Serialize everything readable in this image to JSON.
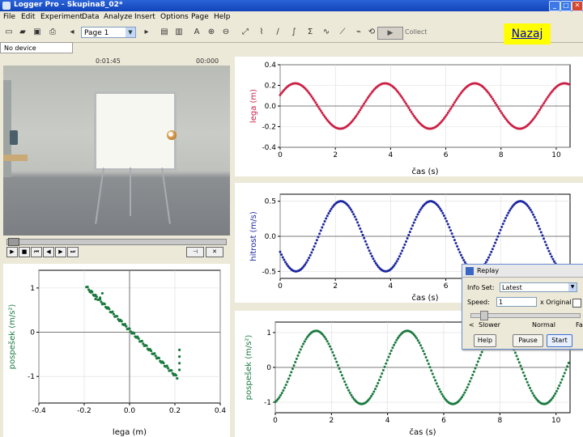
{
  "window": {
    "title": "Logger Pro - Skupina8_02*",
    "min_glyph": "_",
    "max_glyph": "□",
    "close_glyph": "✕"
  },
  "menu": [
    "File",
    "Edit",
    "Experiment",
    "Data",
    "Analyze",
    "Insert",
    "Options",
    "Page",
    "Help"
  ],
  "toolbar": {
    "page_select": "Page 1",
    "collect_label": "Collect",
    "icons": [
      "new-file-icon",
      "open-folder-icon",
      "save-icon",
      "print-icon",
      "page-back-icon",
      "page-forward-icon",
      "table-icon",
      "data-browser-icon",
      "text-annotation-icon",
      "zoom-in-icon",
      "zoom-out-icon",
      "autoscale-icon",
      "examine-icon",
      "tangent-icon",
      "integral-icon",
      "stats-icon",
      "curve-fit-icon",
      "linear-fit-icon",
      "fft-icon",
      "replay-icon",
      "stopwatch-icon",
      "calculator-icon"
    ]
  },
  "nazaj": "Nazaj",
  "status": "No device connected.",
  "video": {
    "time_left": "0:01:45",
    "time_right": "00:000",
    "buttons": [
      "play",
      "stop",
      "rewind",
      "back",
      "forward",
      "end"
    ]
  },
  "replay": {
    "title": "Replay",
    "info_label": "Info Set:",
    "info_value": "Latest",
    "speed_label": "Speed:",
    "speed_value": "1",
    "x_original": "x Original",
    "slower": "Slower",
    "normal": "Normal",
    "faster": "Fa",
    "buttons": {
      "help": "Help",
      "pause": "Pause",
      "start": "Start"
    }
  },
  "colors": {
    "position": "#cc1f44",
    "velocity": "#1c27a0",
    "acceleration": "#1a7a3e"
  },
  "chart_data": [
    {
      "type": "scatter",
      "name": "position-vs-time",
      "ylabel": "lega (m)",
      "xlabel": "čas (s)",
      "xlim": [
        0,
        10.5
      ],
      "ylim": [
        -0.4,
        0.4
      ],
      "xticks": [
        "0",
        "2",
        "4",
        "6",
        "8",
        "10"
      ],
      "yticks": [
        "0.4",
        "0.2",
        "0.0",
        "-0.2",
        "-0.4"
      ],
      "series": [
        {
          "amplitude": 0.22,
          "period": 3.25,
          "phase_shift": 0.55,
          "x_start": 0.0,
          "x_end": 10.45
        }
      ]
    },
    {
      "type": "scatter",
      "name": "velocity-vs-time",
      "ylabel": "hitrost (m/s)",
      "xlabel": "čas (s)",
      "xlim": [
        0,
        10.5
      ],
      "ylim": [
        -0.6,
        0.6
      ],
      "xticks": [
        "0",
        "2",
        "4",
        "6",
        "8",
        "10"
      ],
      "yticks": [
        "0.5",
        "0.0",
        "-0.5"
      ],
      "series": [
        {
          "amplitude": 0.5,
          "period": 3.25,
          "phase_shift": 2.2,
          "x_start": 0.0,
          "x_end": 10.45
        }
      ]
    },
    {
      "type": "scatter",
      "name": "acceleration-vs-time",
      "ylabel": "pospešek (m/s²)",
      "xlabel": "čas (s)",
      "xlim": [
        0,
        10.5
      ],
      "ylim": [
        -1.3,
        1.3
      ],
      "xticks": [
        "0",
        "2",
        "4",
        "6",
        "8",
        "10"
      ],
      "yticks": [
        "1",
        "0",
        "-1"
      ],
      "series": [
        {
          "amplitude": 1.05,
          "period": 3.25,
          "phase_shift": 1.45,
          "x_start": 0.0,
          "x_end": 10.45
        }
      ]
    },
    {
      "type": "scatter",
      "name": "acceleration-vs-position",
      "ylabel": "pospešek (m/s²)",
      "xlabel": "lega (m)",
      "xlim": [
        -0.4,
        0.4
      ],
      "ylim": [
        -1.6,
        1.4
      ],
      "xticks": [
        "-0.4",
        "-0.2",
        "0.0",
        "0.2",
        "0.4"
      ],
      "yticks": [
        "1",
        "0",
        "-1"
      ],
      "points_line": [
        [
          -0.19,
          1.02
        ],
        [
          0.21,
          -1.02
        ]
      ],
      "extra_points": [
        [
          -0.17,
          0.9
        ],
        [
          -0.15,
          0.75
        ],
        [
          -0.13,
          0.78
        ],
        [
          -0.12,
          0.88
        ],
        [
          0.22,
          -0.4
        ],
        [
          0.22,
          -0.55
        ],
        [
          0.22,
          -0.7
        ],
        [
          0.22,
          -0.85
        ]
      ]
    }
  ]
}
